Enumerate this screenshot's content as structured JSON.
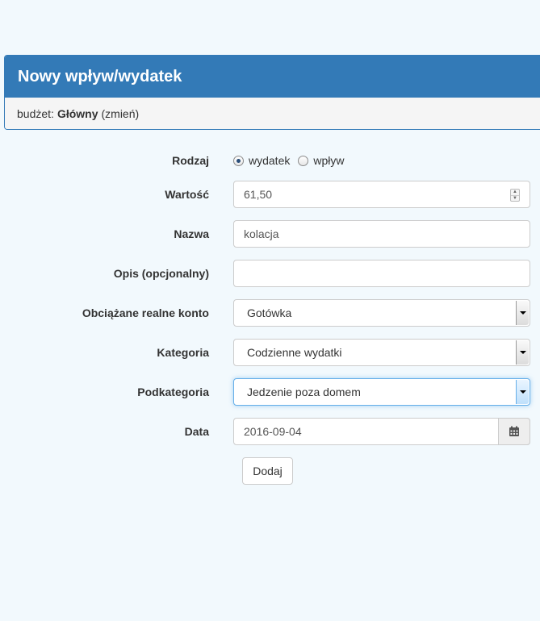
{
  "panel": {
    "title": "Nowy wpływ/wydatek",
    "budget_label": "budżet:",
    "budget_name": "Główny",
    "change_link": "(zmień)"
  },
  "form": {
    "type": {
      "label": "Rodzaj",
      "options": [
        {
          "label": "wydatek",
          "checked": true
        },
        {
          "label": "wpływ",
          "checked": false
        }
      ]
    },
    "amount": {
      "label": "Wartość",
      "value": "61,50"
    },
    "name": {
      "label": "Nazwa",
      "value": "kolacja"
    },
    "description": {
      "label": "Opis (opcjonalny)",
      "value": ""
    },
    "account": {
      "label": "Obciążane realne konto",
      "value": "Gotówka"
    },
    "category": {
      "label": "Kategoria",
      "value": "Codzienne wydatki"
    },
    "subcategory": {
      "label": "Podkategoria",
      "value": "Jedzenie poza domem"
    },
    "date": {
      "label": "Data",
      "value": "2016-09-04"
    },
    "submit_label": "Dodaj"
  },
  "icons": {
    "spinner": "number-spinner-icon",
    "select_arrow": "chevron-down-icon",
    "calendar": "calendar-icon"
  },
  "colors": {
    "header": "#337ab7",
    "background": "#f2f9fd",
    "focus": "#66afe9"
  }
}
